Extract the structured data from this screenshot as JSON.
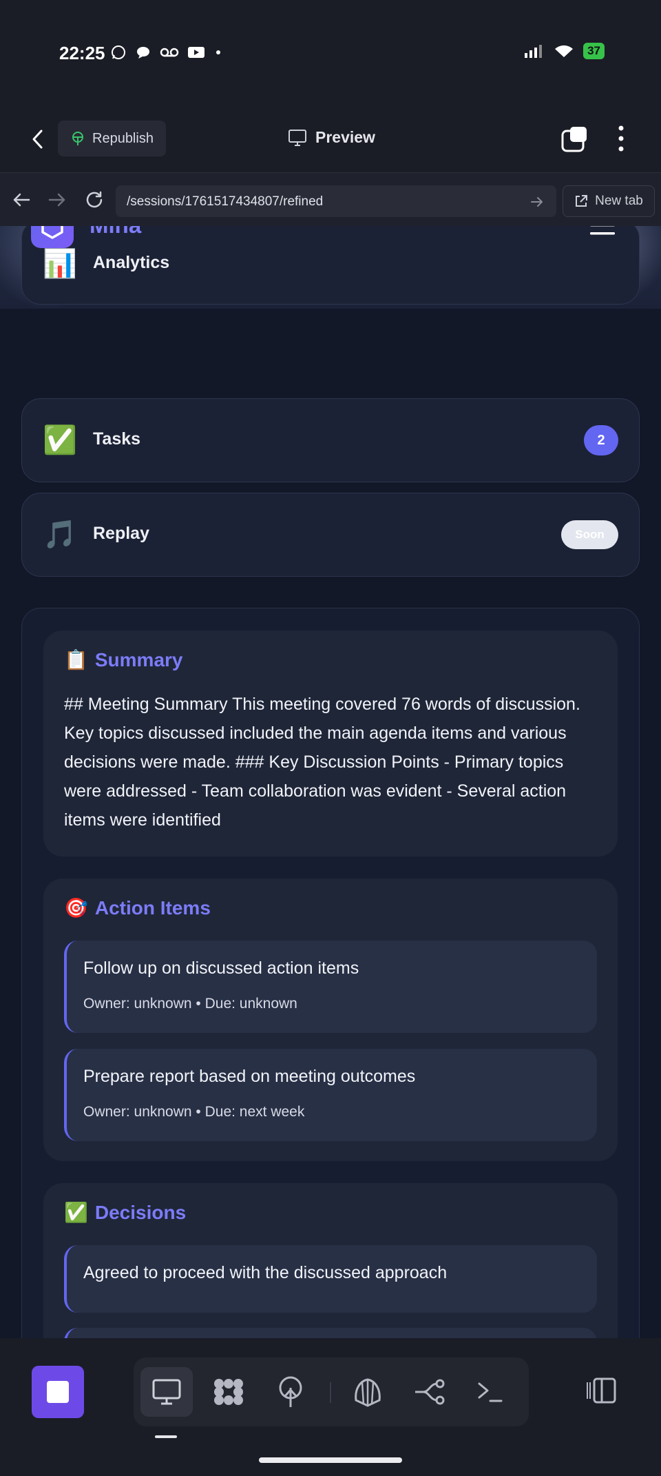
{
  "status_bar": {
    "time": "22:25",
    "battery": "37",
    "icons": [
      "whatsapp-icon",
      "chat-icon",
      "voicemail-icon",
      "youtube-icon",
      "dot-icon",
      "signal-icon",
      "wifi-icon",
      "battery-icon"
    ]
  },
  "toolbar": {
    "republish_label": "Republish",
    "preview_label": "Preview"
  },
  "url_bar": {
    "url": "/sessions/1761517434807/refined",
    "new_tab_label": "New tab"
  },
  "site": {
    "brand": "Mina"
  },
  "nav_cards": [
    {
      "icon": "📊",
      "label": "Analytics"
    },
    {
      "icon": "✅",
      "label": "Tasks",
      "badge": "2"
    },
    {
      "icon": "🎵",
      "label": "Replay",
      "badge": "Soon"
    }
  ],
  "summary": {
    "icon": "📋",
    "title": "Summary",
    "text": "## Meeting Summary This meeting covered 76 words of discussion. Key topics discussed included the main agenda items and various decisions were made. ### Key Discussion Points - Primary topics were addressed - Team collaboration was evident - Several action items were identified"
  },
  "action_items": {
    "icon": "🎯",
    "title": "Action Items",
    "items": [
      {
        "title": "Follow up on discussed action items",
        "meta": "Owner: unknown • Due: unknown"
      },
      {
        "title": "Prepare report based on meeting outcomes",
        "meta": "Owner: unknown • Due: next week"
      }
    ]
  },
  "decisions": {
    "icon": "✅",
    "title": "Decisions",
    "items": [
      {
        "title": "Agreed to proceed with the discussed approach"
      }
    ]
  },
  "colors": {
    "accent": "#6366f1",
    "background": "#121828",
    "card": "#1c2235"
  }
}
